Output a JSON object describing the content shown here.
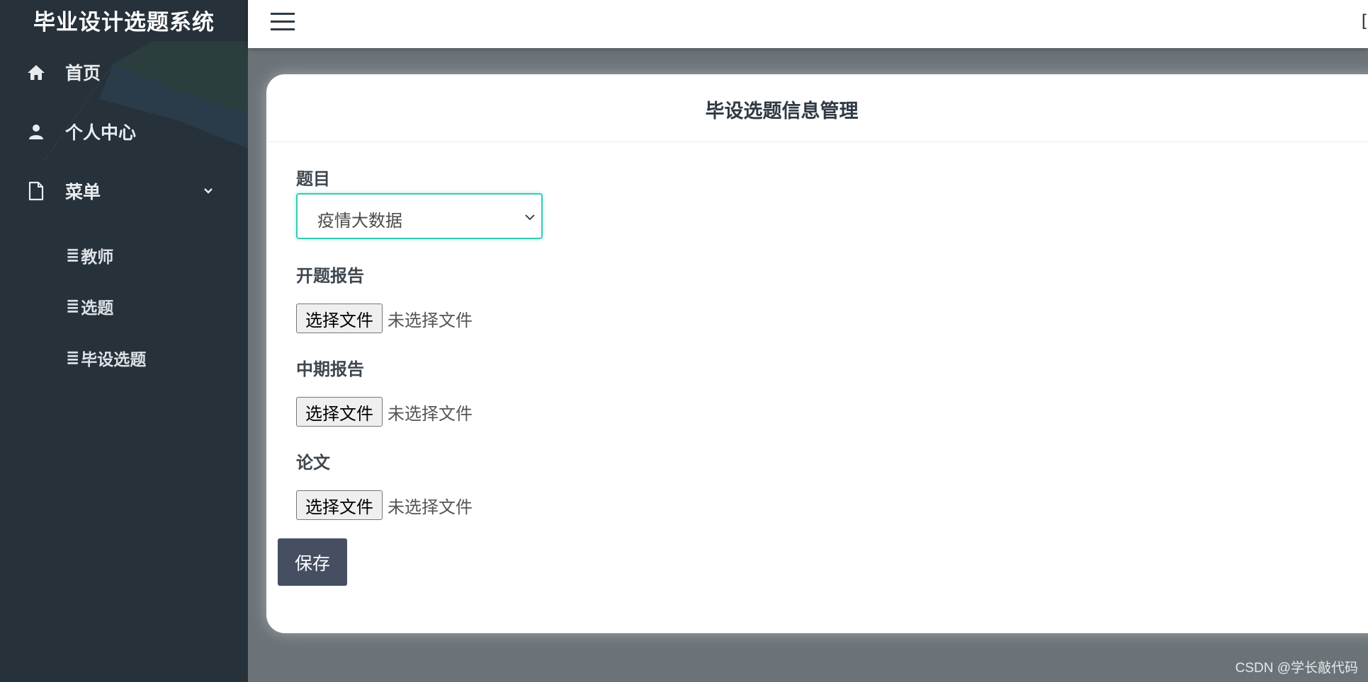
{
  "app": {
    "title": "毕业设计选题系统"
  },
  "sidebar": {
    "items": [
      {
        "label": "首页",
        "icon": "home-icon"
      },
      {
        "label": "个人中心",
        "icon": "person-icon"
      },
      {
        "label": "菜单",
        "icon": "document-icon",
        "expanded": true
      }
    ],
    "submenu": [
      {
        "glyph": "≣",
        "label": "教师"
      },
      {
        "glyph": "≣",
        "label": "选题"
      },
      {
        "glyph": "≣",
        "label": "毕设选题"
      }
    ]
  },
  "topbar": {
    "right_fragment": "["
  },
  "form": {
    "title": "毕设选题信息管理",
    "topic_label": "题目",
    "topic_value": "疫情大数据",
    "fields": [
      {
        "label": "开题报告",
        "button": "选择文件",
        "status": "未选择文件"
      },
      {
        "label": "中期报告",
        "button": "选择文件",
        "status": "未选择文件"
      },
      {
        "label": "论文",
        "button": "选择文件",
        "status": "未选择文件"
      }
    ],
    "save_label": "保存"
  },
  "watermark": "CSDN @学长敲代码",
  "colors": {
    "sidebar_bg": "#26313a",
    "content_bg": "#6b7378",
    "select_border": "#39cbb4",
    "save_button": "#454f61"
  }
}
